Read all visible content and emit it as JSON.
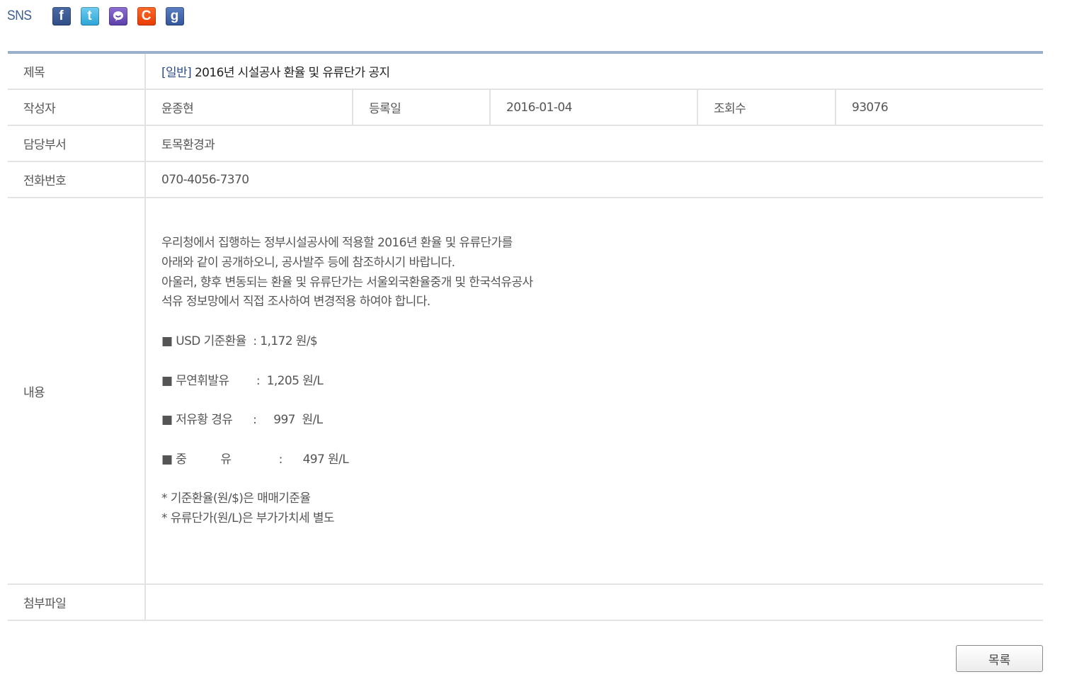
{
  "sns": {
    "label": "SNS",
    "icons": [
      "facebook-icon",
      "twitter-icon",
      "me2day-icon",
      "cyworld-icon",
      "google-icon"
    ]
  },
  "post": {
    "title_label": "제목",
    "category": "[일반]",
    "title": "2016년 시설공사 환율 및 유류단가 공지",
    "author_label": "작성자",
    "author": "윤종현",
    "date_label": "등록일",
    "date": "2016-01-04",
    "views_label": "조회수",
    "views": "93076",
    "dept_label": "담당부서",
    "dept": "토목환경과",
    "phone_label": "전화번호",
    "phone": "070-4056-7370",
    "content_label": "내용",
    "content_lines": [
      "우리청에서 집행하는 정부시설공사에 적용할 2016년 환율 및 유류단가를",
      "아래와 같이 공개하오니, 공사발주 등에 참조하시기 바랍니다.",
      "아울러, 향후 변동되는 환율 및 유류단가는 서울외국환율중개 및 한국석유공사",
      "석유 정보망에서 직접 조사하여 변경적용 하여야 합니다.",
      "",
      "■ USD 기준환율  : 1,172 원/$",
      "",
      "■ 무연휘발유        :  1,205 원/L",
      "",
      "■ 저유황 경유      :     997  원/L",
      "",
      "■ 중          유              :      497 원/L",
      "",
      "* 기준환율(원/$)은 매매기준율",
      "* 유류단가(원/L)은 부가가치세 별도"
    ],
    "attachment_label": "첨부파일"
  },
  "buttons": {
    "list_label": "목록"
  },
  "colors": {
    "header_rule": "#9bb0ca",
    "category": "#2a4a8a",
    "sns_label": "#3a5f8f"
  }
}
